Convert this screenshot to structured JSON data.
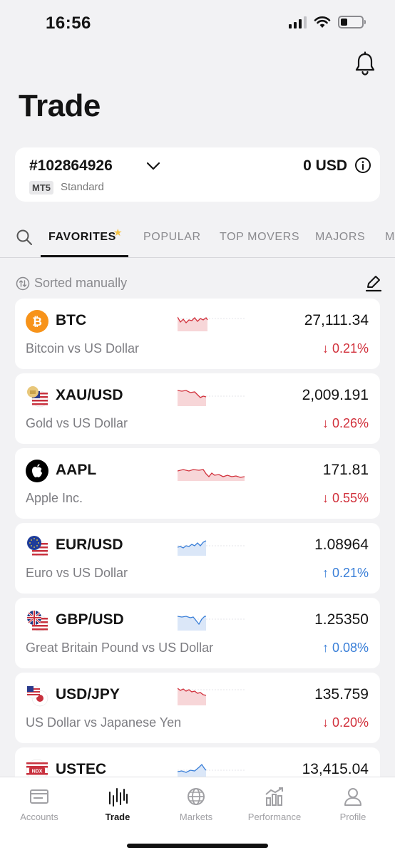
{
  "status_bar": {
    "time": "16:56"
  },
  "header": {
    "title": "Trade"
  },
  "account": {
    "number": "#102864926",
    "platform_tag": "MT5",
    "type": "Standard",
    "balance": "0 USD"
  },
  "tabs": [
    {
      "label": "FAVORITES",
      "active": true
    },
    {
      "label": "POPULAR",
      "active": false
    },
    {
      "label": "TOP MOVERS",
      "active": false
    },
    {
      "label": "MAJORS",
      "active": false
    },
    {
      "label": "M",
      "active": false
    }
  ],
  "sort": {
    "label": "Sorted manually"
  },
  "instruments": [
    {
      "symbol": "BTC",
      "name": "Bitcoin vs US Dollar",
      "price": "27,111.34",
      "change": "↓ 0.21%",
      "direction": "down",
      "icon": "bitcoin-icon"
    },
    {
      "symbol": "XAU/USD",
      "name": "Gold vs US Dollar",
      "price": "2,009.191",
      "change": "↓ 0.26%",
      "direction": "down",
      "icon": "gold-flag-icon"
    },
    {
      "symbol": "AAPL",
      "name": "Apple Inc.",
      "price": "171.81",
      "change": "↓ 0.55%",
      "direction": "down",
      "icon": "apple-icon"
    },
    {
      "symbol": "EUR/USD",
      "name": "Euro vs US Dollar",
      "price": "1.08964",
      "change": "↑ 0.21%",
      "direction": "up",
      "icon": "eu-us-flag-icon"
    },
    {
      "symbol": "GBP/USD",
      "name": "Great Britain Pound vs US Dollar",
      "price": "1.25350",
      "change": "↑ 0.08%",
      "direction": "up",
      "icon": "gb-us-flag-icon"
    },
    {
      "symbol": "USD/JPY",
      "name": "US Dollar vs Japanese Yen",
      "price": "135.759",
      "change": "↓ 0.20%",
      "direction": "down",
      "icon": "us-jp-flag-icon"
    },
    {
      "symbol": "USTEC",
      "name": "",
      "price": "13,415.04",
      "change": "",
      "direction": "up",
      "icon": "ndx-us-flag-icon"
    }
  ],
  "bottom_nav": [
    {
      "label": "Accounts",
      "icon": "wallet-icon",
      "active": false
    },
    {
      "label": "Trade",
      "icon": "chart-bars-icon",
      "active": true
    },
    {
      "label": "Markets",
      "icon": "globe-icon",
      "active": false
    },
    {
      "label": "Performance",
      "icon": "performance-icon",
      "active": false
    },
    {
      "label": "Profile",
      "icon": "user-icon",
      "active": false
    }
  ],
  "colors": {
    "down": "#d1303b",
    "up": "#3a7fd8",
    "background": "#f2f2f4",
    "accent_star": "#f6c343"
  }
}
